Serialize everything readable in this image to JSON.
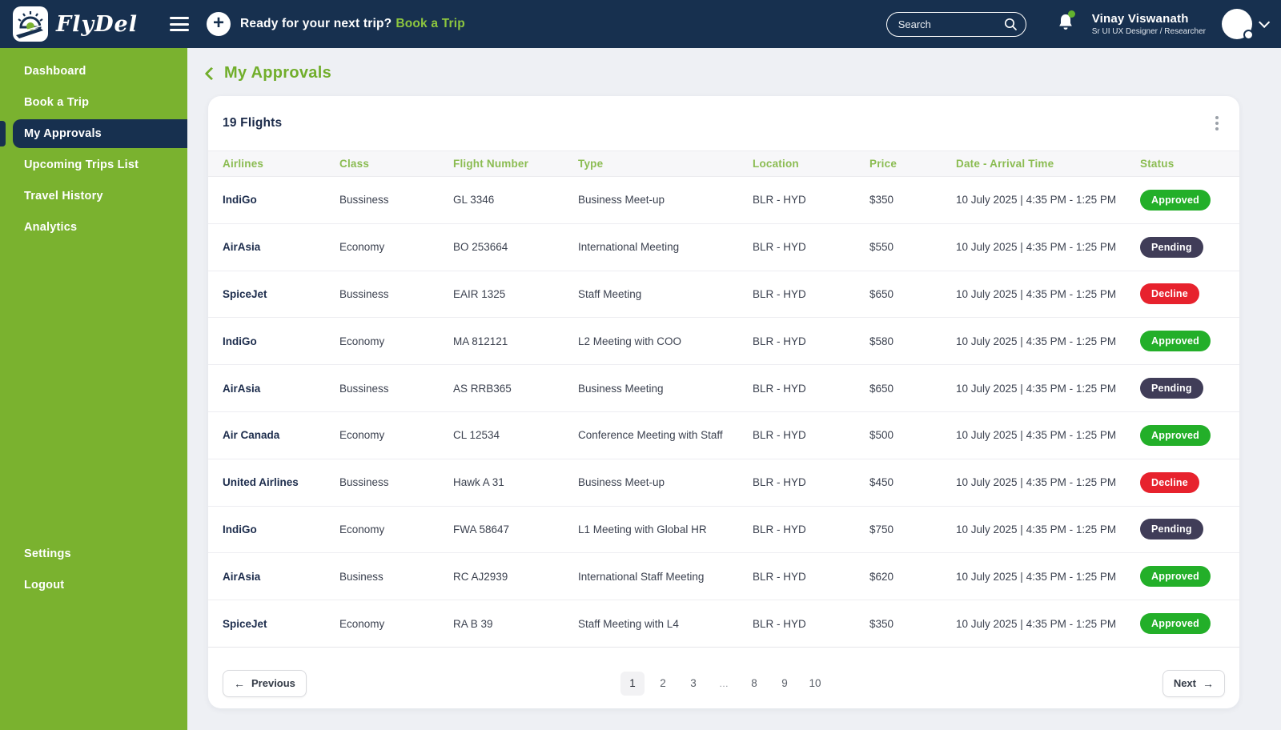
{
  "header": {
    "brand": "FlyDel",
    "trip_prompt": "Ready for your next trip?",
    "book_trip_label": "Book a Trip",
    "search_placeholder": "Search",
    "user_name": "Vinay Viswanath",
    "user_role": "Sr UI UX Designer / Researcher"
  },
  "sidebar": {
    "items": [
      {
        "label": "Dashboard",
        "active": false
      },
      {
        "label": "Book a Trip",
        "active": false
      },
      {
        "label": "My Approvals",
        "active": true
      },
      {
        "label": "Upcoming Trips List",
        "active": false
      },
      {
        "label": "Travel History",
        "active": false
      },
      {
        "label": "Analytics",
        "active": false
      }
    ],
    "footer_items": [
      {
        "label": "Settings"
      },
      {
        "label": "Logout"
      }
    ]
  },
  "page": {
    "title": "My Approvals",
    "card_title": "19 Flights"
  },
  "table": {
    "columns": [
      "Airlines",
      "Class",
      "Flight Number",
      "Type",
      "Location",
      "Price",
      "Date - Arrival Time",
      "Status"
    ],
    "rows": [
      {
        "airline": "IndiGo",
        "class": "Bussiness",
        "flight_number": "GL 3346",
        "type": "Business Meet-up",
        "location": "BLR - HYD",
        "price": "$350",
        "date": "10 July 2025 | 4:35 PM - 1:25 PM",
        "status": "Approved"
      },
      {
        "airline": "AirAsia",
        "class": "Economy",
        "flight_number": "BO 253664",
        "type": "International Meeting",
        "location": "BLR - HYD",
        "price": "$550",
        "date": "10 July 2025 | 4:35 PM - 1:25 PM",
        "status": "Pending"
      },
      {
        "airline": "SpiceJet",
        "class": "Bussiness",
        "flight_number": "EAIR 1325",
        "type": "Staff Meeting",
        "location": "BLR - HYD",
        "price": "$650",
        "date": "10 July 2025 | 4:35 PM - 1:25 PM",
        "status": "Decline"
      },
      {
        "airline": "IndiGo",
        "class": "Economy",
        "flight_number": "MA 812121",
        "type": "L2 Meeting with COO",
        "location": "BLR - HYD",
        "price": "$580",
        "date": "10 July 2025 | 4:35 PM - 1:25 PM",
        "status": "Approved"
      },
      {
        "airline": "AirAsia",
        "class": "Bussiness",
        "flight_number": "AS RRB365",
        "type": "Business Meeting",
        "location": "BLR - HYD",
        "price": "$650",
        "date": "10 July 2025 | 4:35 PM - 1:25 PM",
        "status": "Pending"
      },
      {
        "airline": "Air Canada",
        "class": "Economy",
        "flight_number": "CL 12534",
        "type": "Conference Meeting with Staff",
        "location": "BLR - HYD",
        "price": "$500",
        "date": "10 July 2025 | 4:35 PM - 1:25 PM",
        "status": "Approved"
      },
      {
        "airline": "United Airlines",
        "class": "Bussiness",
        "flight_number": "Hawk A 31",
        "type": "Business Meet-up",
        "location": "BLR - HYD",
        "price": "$450",
        "date": "10 July 2025 | 4:35 PM - 1:25 PM",
        "status": "Decline"
      },
      {
        "airline": "IndiGo",
        "class": "Economy",
        "flight_number": "FWA 58647",
        "type": "L1 Meeting with Global HR",
        "location": "BLR - HYD",
        "price": "$750",
        "date": "10 July 2025 | 4:35 PM - 1:25 PM",
        "status": "Pending"
      },
      {
        "airline": "AirAsia",
        "class": "Business",
        "flight_number": "RC AJ2939",
        "type": "International Staff Meeting",
        "location": "BLR - HYD",
        "price": "$620",
        "date": "10 July 2025 | 4:35 PM - 1:25 PM",
        "status": "Approved"
      },
      {
        "airline": "SpiceJet",
        "class": "Economy",
        "flight_number": "RA B 39",
        "type": "Staff Meeting with L4",
        "location": "BLR - HYD",
        "price": "$350",
        "date": "10 July 2025 | 4:35 PM - 1:25 PM",
        "status": "Approved"
      }
    ]
  },
  "pagination": {
    "previous_label": "Previous",
    "next_label": "Next",
    "pages": [
      "1",
      "2",
      "3",
      "...",
      "8",
      "9",
      "10"
    ],
    "current_page": "1"
  },
  "colors": {
    "navy": "#17304f",
    "sidebar_green": "#7ab22f",
    "link_green": "#8dc63f",
    "title_green": "#71ae2b",
    "approved": "#23af29",
    "pending": "#403d58",
    "declined": "#e7222d"
  }
}
